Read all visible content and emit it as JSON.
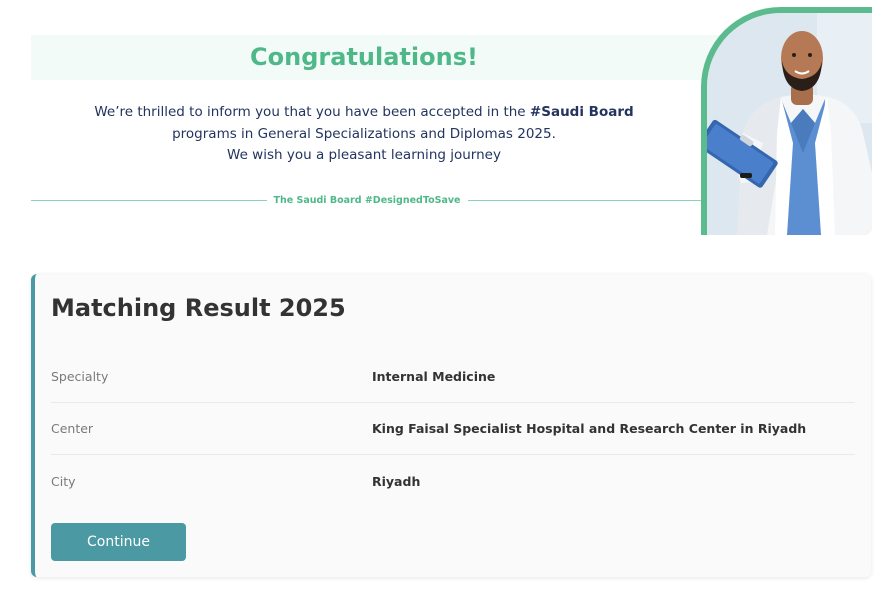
{
  "banner": {
    "title": "Congratulations!",
    "message_line1_pre": "We’re thrilled to inform you that you have been accepted in the ",
    "message_line1_bold": "#Saudi Board",
    "message_line2": "programs in General Specializations and Diplomas 2025.",
    "message_line3": "We wish you a pleasant learning journey",
    "tagline": "The Saudi Board #DesignedToSave"
  },
  "result": {
    "title": "Matching Result 2025",
    "rows": [
      {
        "label": "Specialty",
        "value": "Internal Medicine"
      },
      {
        "label": "Center",
        "value": "King Faisal Specialist Hospital and Research Center in Riyadh"
      },
      {
        "label": "City",
        "value": "Riyadh"
      }
    ],
    "continue_label": "Continue"
  },
  "colors": {
    "brand_green": "#4fb889",
    "accent_teal": "#4b9aa3",
    "text_navy": "#22345f"
  }
}
